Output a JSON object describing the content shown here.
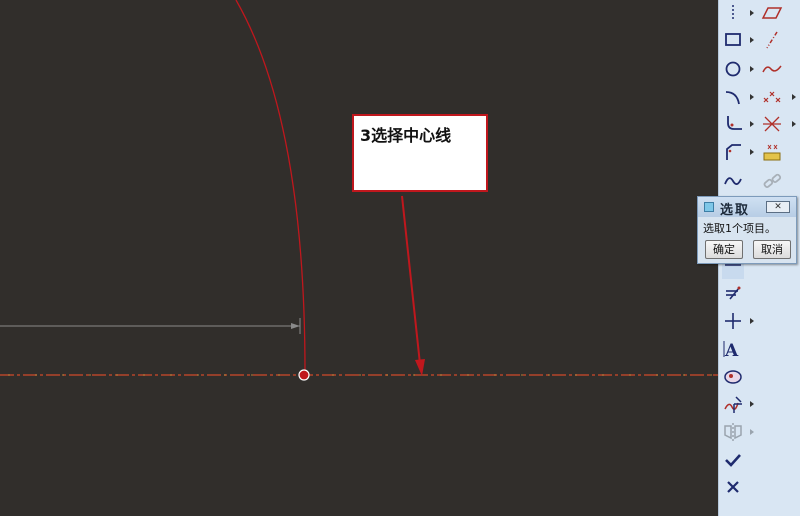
{
  "callout": {
    "text": "3选择中心线"
  },
  "select_dialog": {
    "title": "选取",
    "close_symbol": "✕",
    "message": "选取1个项目。",
    "ok_label": "确定",
    "cancel_label": "取消"
  },
  "colors": {
    "canvas_background": "#312e2b",
    "sketch_curve": "#c0171d",
    "centerline": "#d04a2a",
    "dimension_line": "#8a8a8a",
    "toolbar_background": "#d9e6f3",
    "icon_blue": "#1f2b6e",
    "icon_red": "#b0302a"
  },
  "toolbar": {
    "icons": [
      "construction-line-icon",
      "parallelogram-icon",
      "rectangle-icon",
      "centerline-dashed-icon",
      "circle-icon",
      "spline-icon",
      "arc-icon",
      "point-icon",
      "fillet-icon",
      "coordinate-system-icon",
      "chamfer-icon",
      "palette-icon",
      "curve-icon",
      "constraint-icon",
      "dimension-icon",
      "offset-icon",
      "centerline-icon",
      "text-icon",
      "palette-shape-icon",
      "trim-icon",
      "mirror-icon",
      "accept-check-icon",
      "cancel-x-icon"
    ]
  }
}
